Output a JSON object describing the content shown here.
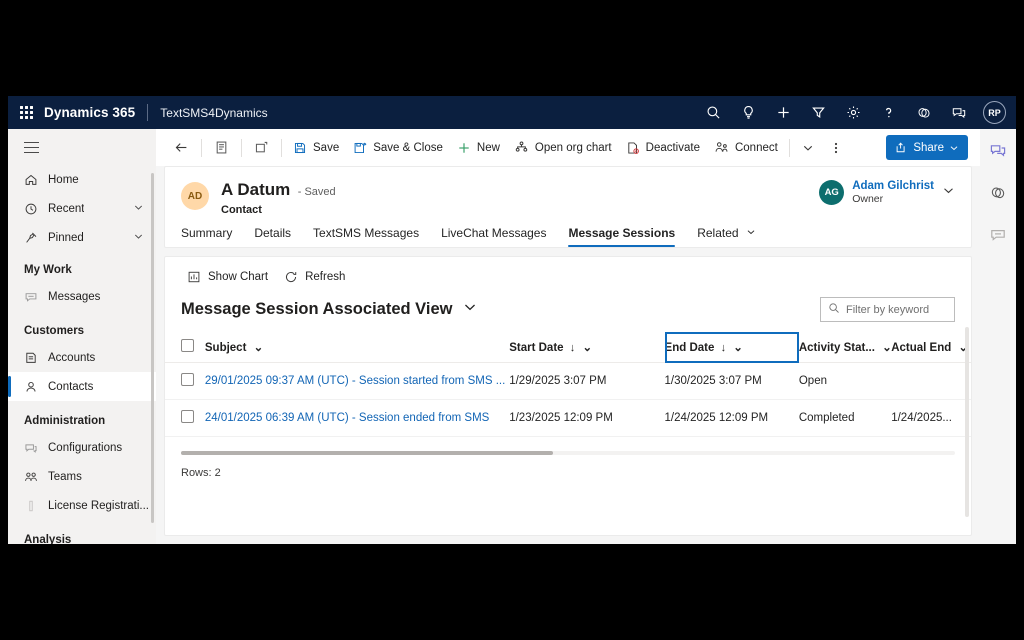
{
  "appbar": {
    "waffle": "app-launcher",
    "brand": "Dynamics 365",
    "app_name": "TextSMS4Dynamics",
    "icons": [
      "search-icon",
      "lightbulb-icon",
      "plus-icon",
      "filter-icon",
      "gear-icon",
      "help-icon",
      "copilot-icon",
      "feedback-icon"
    ],
    "avatar_initials": "RP",
    "bg_color": "#0b1f3f"
  },
  "sidebar": {
    "hamburger": "site-map-toggle",
    "items": [
      {
        "label": "Home",
        "icon": "home-icon"
      },
      {
        "label": "Recent",
        "icon": "clock-icon",
        "chevron": true
      },
      {
        "label": "Pinned",
        "icon": "pin-icon",
        "chevron": true
      }
    ],
    "groups": [
      {
        "title": "My Work",
        "items": [
          {
            "label": "Messages",
            "icon": "message-icon"
          }
        ]
      },
      {
        "title": "Customers",
        "items": [
          {
            "label": "Accounts",
            "icon": "account-icon"
          },
          {
            "label": "Contacts",
            "icon": "contact-icon",
            "selected": true
          }
        ]
      },
      {
        "title": "Administration",
        "items": [
          {
            "label": "Configurations",
            "icon": "configuration-icon"
          },
          {
            "label": "Teams",
            "icon": "teams-icon"
          },
          {
            "label": "License Registrati...",
            "icon": "license-icon"
          }
        ]
      },
      {
        "title": "Analysis",
        "items": []
      }
    ]
  },
  "commandbar": {
    "back": "back-arrow-icon",
    "form_icon": "form-icon",
    "popout_icon": "open-in-new-window-icon",
    "buttons": [
      {
        "label": "Save",
        "icon": "save-icon"
      },
      {
        "label": "Save & Close",
        "icon": "save-close-icon"
      },
      {
        "label": "New",
        "icon": "plus-icon"
      },
      {
        "label": "Open org chart",
        "icon": "org-chart-icon"
      },
      {
        "label": "Deactivate",
        "icon": "deactivate-icon"
      },
      {
        "label": "Connect",
        "icon": "connect-icon"
      }
    ],
    "more_chevron": "chevron-down-icon",
    "overflow": "more-options-icon",
    "share_label": "Share",
    "share_color": "#0f6cbd"
  },
  "record": {
    "avatar_initials": "AD",
    "title": "A Datum",
    "saved_status": "- Saved",
    "entity": "Contact",
    "owner": {
      "avatar_initials": "AG",
      "name": "Adam Gilchrist",
      "role": "Owner"
    }
  },
  "tabs": [
    {
      "label": "Summary",
      "active": false
    },
    {
      "label": "Details",
      "active": false
    },
    {
      "label": "TextSMS Messages",
      "active": false
    },
    {
      "label": "LiveChat Messages",
      "active": false
    },
    {
      "label": "Message Sessions",
      "active": true
    },
    {
      "label": "Related",
      "active": false,
      "chevron": true
    }
  ],
  "grid": {
    "tools": [
      {
        "label": "Show Chart",
        "icon": "chart-icon"
      },
      {
        "label": "Refresh",
        "icon": "refresh-icon"
      }
    ],
    "view_name": "Message Session Associated View",
    "view_chevron": "chevron-down-icon",
    "search": {
      "placeholder": "Filter by keyword",
      "value": "",
      "icon": "search-icon"
    },
    "columns": [
      {
        "label": "Subject",
        "sort": "",
        "focused": false
      },
      {
        "label": "Start Date",
        "sort": "↓",
        "focused": false
      },
      {
        "label": "End Date",
        "sort": "↓",
        "focused": true
      },
      {
        "label": "Activity Stat...",
        "sort": "",
        "focused": false
      },
      {
        "label": "Actual End",
        "sort": "",
        "focused": false
      }
    ],
    "rows": [
      {
        "subject": "29/01/2025 09:37 AM (UTC) - Session started from SMS ...",
        "start_date": "1/29/2025 3:07 PM",
        "end_date": "1/30/2025 3:07 PM",
        "activity_status": "Open",
        "actual_end": ""
      },
      {
        "subject": "24/01/2025 06:39 AM (UTC) - Session ended from SMS",
        "start_date": "1/23/2025 12:09 PM",
        "end_date": "1/24/2025 12:09 PM",
        "activity_status": "Completed",
        "actual_end": "1/24/2025..."
      }
    ],
    "rows_label": "Rows: 2",
    "link_color": "#1265b5"
  },
  "rail": {
    "icons": [
      "chat-assistant-icon",
      "copilot-icon",
      "message-bubble-icon"
    ]
  }
}
